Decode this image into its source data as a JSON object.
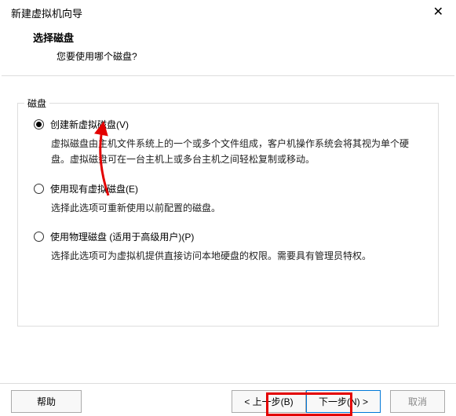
{
  "window": {
    "title": "新建虚拟机向导",
    "close": "✕"
  },
  "header": {
    "title": "选择磁盘",
    "question": "您要使用哪个磁盘?"
  },
  "group": {
    "legend": "磁盘"
  },
  "options": {
    "create": {
      "label": "创建新虚拟磁盘(V)",
      "desc": "虚拟磁盘由主机文件系统上的一个或多个文件组成，客户机操作系统会将其视为单个硬盘。虚拟磁盘可在一台主机上或多台主机之间轻松复制或移动。"
    },
    "existing": {
      "label": "使用现有虚拟磁盘(E)",
      "desc": "选择此选项可重新使用以前配置的磁盘。"
    },
    "physical": {
      "label": "使用物理磁盘 (适用于高级用户)(P)",
      "desc": "选择此选项可为虚拟机提供直接访问本地硬盘的权限。需要具有管理员特权。"
    }
  },
  "buttons": {
    "help": "帮助",
    "back": "< 上一步(B)",
    "next": "下一步(N) >",
    "cancel": "取消"
  }
}
